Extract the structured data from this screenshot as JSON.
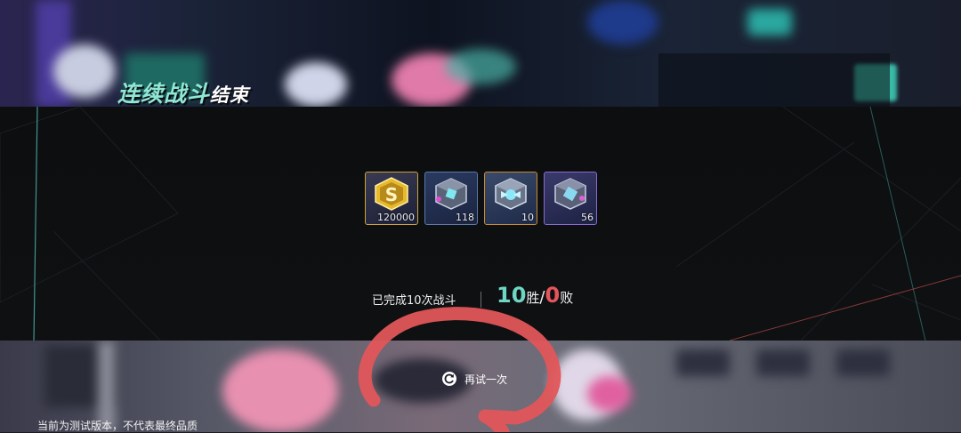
{
  "header": {
    "title_part1": "连续战斗",
    "title_part2": "结束"
  },
  "rewards": [
    {
      "name": "gold-coin-icon",
      "count": "120000"
    },
    {
      "name": "blue-cube-icon",
      "count": "118"
    },
    {
      "name": "gold-cube-icon",
      "count": "10"
    },
    {
      "name": "purple-cube-icon",
      "count": "56"
    }
  ],
  "stats": {
    "completed_text": "已完成10次战斗",
    "wins": "10",
    "wins_suffix": "胜",
    "separator": "/",
    "losses": "0",
    "losses_suffix": "败"
  },
  "retry": {
    "label": "再试一次"
  },
  "footer": {
    "notice": "当前为测试版本，不代表最终品质"
  },
  "colors": {
    "win": "#6fd6c4",
    "loss": "#e5555b",
    "annotation": "#e0565a"
  }
}
